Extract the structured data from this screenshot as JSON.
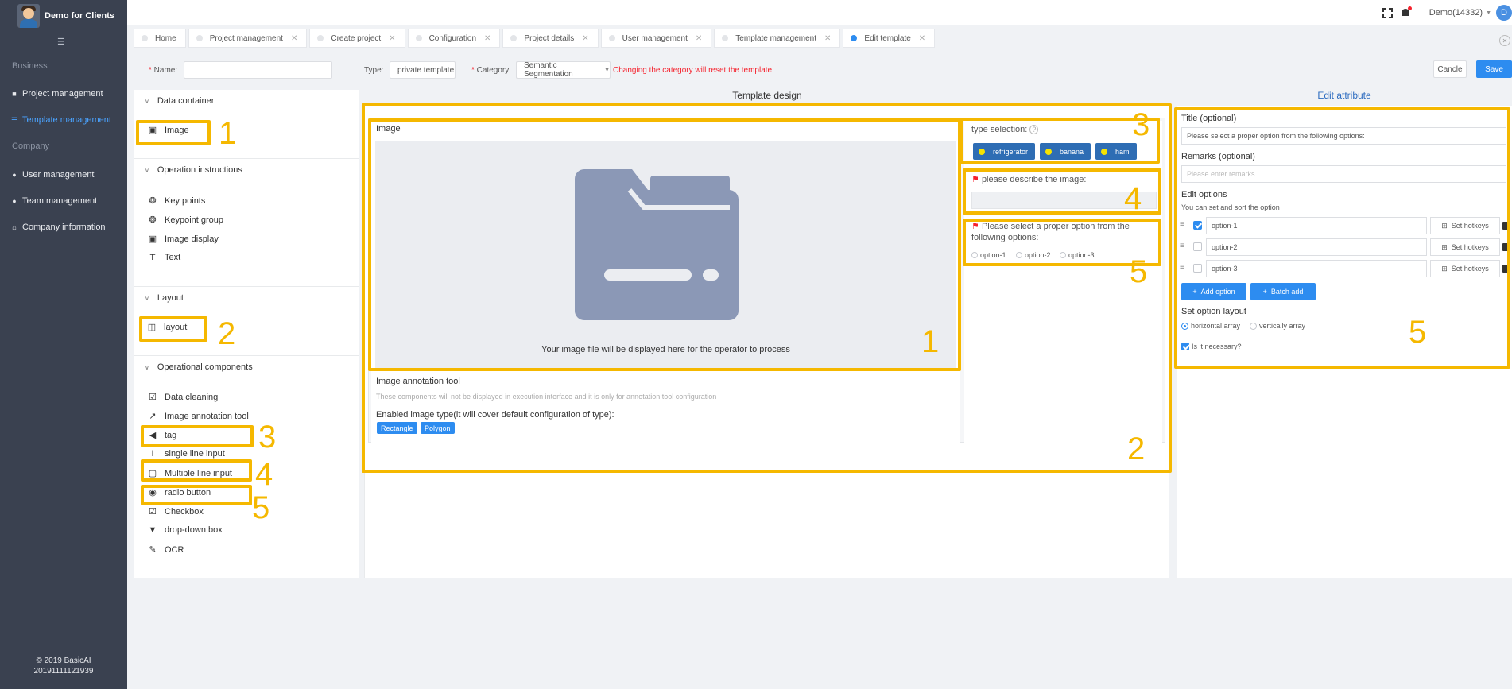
{
  "app": {
    "title": "Demo for Clients",
    "copyright": "© 2019 BasicAI",
    "build": "20191111121939"
  },
  "sidebar": {
    "sections": [
      {
        "label": "Business"
      },
      {
        "label": "Company"
      }
    ],
    "items": [
      {
        "label": "Project management",
        "icon": "book-icon"
      },
      {
        "label": "Template management",
        "icon": "grid-list-icon",
        "active": true
      },
      {
        "label": "User management",
        "icon": "users-icon"
      },
      {
        "label": "Team management",
        "icon": "team-icon"
      },
      {
        "label": "Company information",
        "icon": "home-icon"
      }
    ]
  },
  "topbar": {
    "user": "Demo(14332)",
    "avatar_letter": "D"
  },
  "tabs": [
    {
      "label": "Home",
      "closable": false
    },
    {
      "label": "Project management",
      "closable": true
    },
    {
      "label": "Create project",
      "closable": true
    },
    {
      "label": "Configuration",
      "closable": true
    },
    {
      "label": "Project details",
      "closable": true
    },
    {
      "label": "User management",
      "closable": true
    },
    {
      "label": "Template management",
      "closable": true
    },
    {
      "label": "Edit template",
      "closable": true,
      "active": true
    }
  ],
  "form": {
    "name_label": "Name:",
    "name_value": "",
    "type_label": "Type:",
    "type_value": "private template",
    "category_label": "Category",
    "category_value": "Semantic Segmentation",
    "category_warning": "Changing the category will reset the template",
    "cancel": "Cancle",
    "save": "Save"
  },
  "components": {
    "groups": [
      {
        "title": "Data container",
        "items": [
          {
            "label": "Image",
            "icon": "image-icon"
          }
        ]
      },
      {
        "title": "Operation instructions",
        "items": [
          {
            "label": "Key points",
            "icon": "keypoint-icon"
          },
          {
            "label": "Keypoint group",
            "icon": "keypoint-group-icon"
          },
          {
            "label": "Image display",
            "icon": "image-icon"
          },
          {
            "label": "Text",
            "icon": "text-icon"
          }
        ]
      },
      {
        "title": "Layout",
        "items": [
          {
            "label": "layout",
            "icon": "layout-icon"
          }
        ]
      },
      {
        "title": "Operational components",
        "items": [
          {
            "label": "Data cleaning",
            "icon": "check-square-icon"
          },
          {
            "label": "Image annotation tool",
            "icon": "hammer-icon"
          },
          {
            "label": "tag",
            "icon": "tag-icon"
          },
          {
            "label": "single line input",
            "icon": "text-cursor-icon"
          },
          {
            "label": "Multiple line input",
            "icon": "textarea-icon"
          },
          {
            "label": "radio button",
            "icon": "radio-icon"
          },
          {
            "label": "Checkbox",
            "icon": "checkbox-icon"
          },
          {
            "label": "drop-down box",
            "icon": "dropdown-icon"
          },
          {
            "label": "OCR",
            "icon": "pen-icon"
          }
        ]
      }
    ]
  },
  "design": {
    "title": "Template design",
    "image_title": "Image",
    "placeholder_caption": "Your image file will be displayed here for the operator to process",
    "annot_title": "Image annotation tool",
    "annot_note": "These components will not be displayed in execution interface and it is only for annotation tool configuration",
    "annot_enabled": "Enabled image type(it will cover default configuration of type):",
    "annot_types": [
      "Rectangle",
      "Polygon"
    ],
    "type_selection_label": "type selection:",
    "chips": [
      "refrigerator",
      "banana",
      "ham"
    ],
    "describe_label": "please describe the image:",
    "select_label": "Please select a proper option from the following options:",
    "radio_options": [
      "option-1",
      "option-2",
      "option-3"
    ]
  },
  "attributes": {
    "title": "Edit attribute",
    "title_label": "Title (optional)",
    "title_value": "Please select a proper option from the following options:",
    "remarks_label": "Remarks (optional)",
    "remarks_placeholder": "Please enter remarks",
    "edit_options_label": "Edit options",
    "edit_options_hint": "You can set and sort the option",
    "options": [
      {
        "value": "option-1",
        "checked": true,
        "hotkey_label": "Set hotkeys"
      },
      {
        "value": "option-2",
        "checked": false,
        "hotkey_label": "Set hotkeys"
      },
      {
        "value": "option-3",
        "checked": false,
        "hotkey_label": "Set hotkeys"
      }
    ],
    "add_option": "Add option",
    "batch_add": "Batch add",
    "layout_label": "Set option layout",
    "layout_options": [
      "horizontal array",
      "vertically array"
    ],
    "necessary_label": "Is it necessary?"
  },
  "annotations": {
    "numbers": [
      "1",
      "2",
      "3",
      "4",
      "5",
      "1",
      "2",
      "3",
      "4",
      "5",
      "5"
    ],
    "color": "#f5b800"
  }
}
